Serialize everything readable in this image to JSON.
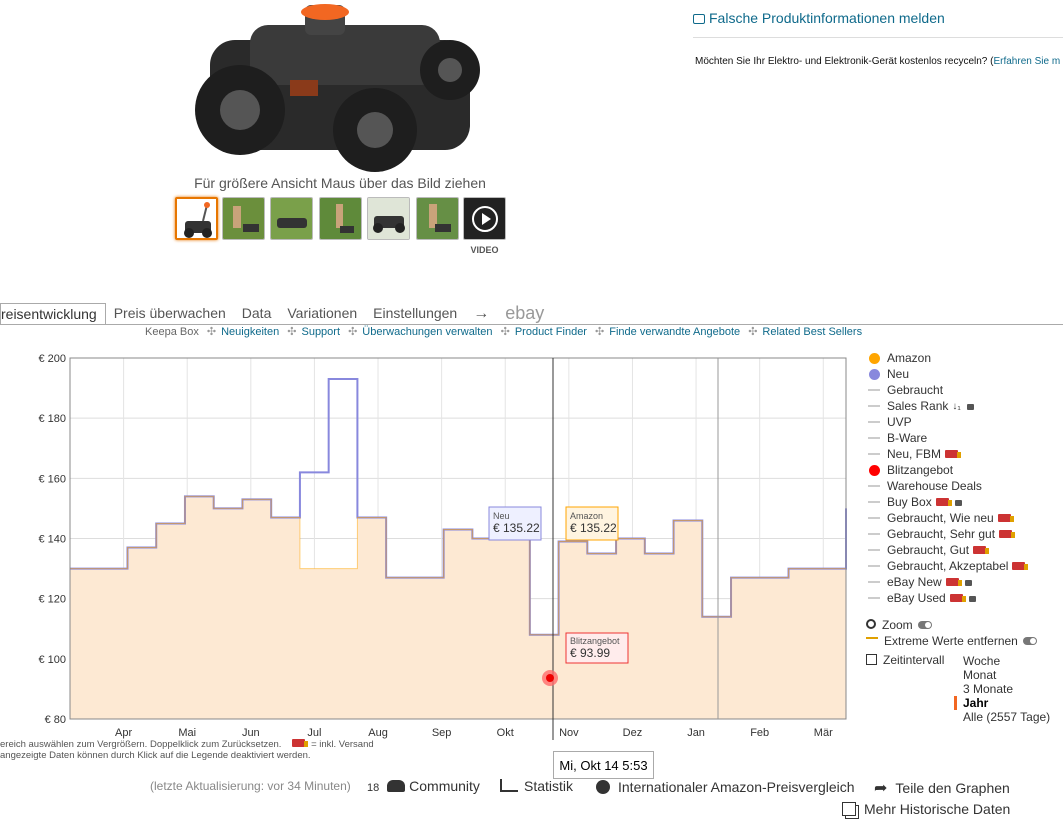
{
  "product": {
    "hover_hint": "Für größere Ansicht Maus über das Bild ziehen",
    "thumbnails": [
      "thumb-1",
      "thumb-2",
      "thumb-3",
      "thumb-4",
      "thumb-5",
      "thumb-6"
    ],
    "video_label": "VIDEO"
  },
  "report": {
    "label": "Falsche Produktinformationen melden",
    "recycle_text": "Möchten Sie Ihr Elektro- und Elektronik-Gerät kostenlos recyceln? (",
    "recycle_link": "Erfahren Sie m"
  },
  "tabs": [
    {
      "label": "reisentwicklung",
      "active": true
    },
    {
      "label": "Preis überwachen"
    },
    {
      "label": "Data"
    },
    {
      "label": "Variationen"
    },
    {
      "label": "Einstellungen"
    },
    {
      "label": "→"
    },
    {
      "label": "ebay"
    }
  ],
  "links": {
    "keepa_box": "Keepa Box",
    "items": [
      "Neuigkeiten",
      "Support",
      "Überwachungen verwalten",
      "Product Finder",
      "Finde verwandte Angebote",
      "Related Best Sellers"
    ]
  },
  "chart_data": {
    "type": "line",
    "y_ticks": [
      "€ 200",
      "€ 180",
      "€ 160",
      "€ 140",
      "€ 120",
      "€ 100",
      "€ 80"
    ],
    "ylim": [
      80,
      200
    ],
    "x_ticks": [
      "Apr",
      "Mai",
      "Jun",
      "Jul",
      "Aug",
      "Sep",
      "Okt",
      "Nov",
      "Dez",
      "Jan",
      "Feb",
      "Mär"
    ],
    "series": [
      {
        "name": "Neu",
        "color": "#8888dd",
        "values": [
          130,
          130,
          137,
          145,
          154,
          150,
          153,
          147,
          162,
          193,
          147,
          127,
          127,
          143,
          140,
          143,
          108,
          139,
          135,
          140,
          135,
          146,
          114,
          127,
          127,
          130,
          130,
          150
        ]
      },
      {
        "name": "Amazon",
        "color": "#ffa500",
        "values": [
          130,
          130,
          137,
          145,
          154,
          150,
          153,
          147,
          130,
          130,
          147,
          127,
          127,
          143,
          140,
          143,
          108,
          139,
          135,
          140,
          135,
          146,
          114,
          127,
          127,
          130,
          130,
          150
        ]
      }
    ],
    "tooltips": {
      "neu": {
        "label": "Neu",
        "value": "€ 135.22"
      },
      "amazon": {
        "label": "Amazon",
        "value": "€ 135.22"
      },
      "blitz": {
        "label": "Blitzangebot",
        "value": "€ 93.99"
      },
      "date": "Mi, Okt 14 5:53"
    }
  },
  "legend": {
    "items": [
      {
        "label": "Amazon",
        "kind": "dot",
        "color": "#ffa500"
      },
      {
        "label": "Neu",
        "kind": "dot",
        "color": "#8888dd"
      },
      {
        "label": "Gebraucht",
        "kind": "dash"
      },
      {
        "label": "Sales Rank",
        "kind": "dash",
        "sort": true,
        "lock": true
      },
      {
        "label": "UVP",
        "kind": "dash"
      },
      {
        "label": "B-Ware",
        "kind": "dash"
      },
      {
        "label": "Neu, FBM",
        "kind": "dash",
        "truck": true
      },
      {
        "label": "Blitzangebot",
        "kind": "dot",
        "color": "#ff0000"
      },
      {
        "label": "Warehouse Deals",
        "kind": "dash"
      },
      {
        "label": "Buy Box",
        "kind": "dash",
        "truck": true,
        "lock": true
      },
      {
        "label": "Gebraucht, Wie neu",
        "kind": "dash",
        "truck": true
      },
      {
        "label": "Gebraucht, Sehr gut",
        "kind": "dash",
        "truck": true
      },
      {
        "label": "Gebraucht, Gut",
        "kind": "dash",
        "truck": true
      },
      {
        "label": "Gebraucht, Akzeptabel",
        "kind": "dash",
        "truck": true
      },
      {
        "label": "eBay New",
        "kind": "dash",
        "truck": true,
        "lock": true
      },
      {
        "label": "eBay Used",
        "kind": "dash",
        "truck": true,
        "lock": true
      }
    ],
    "zoom": "Zoom",
    "extreme": "Extreme Werte entfernen",
    "interval": "Zeitintervall",
    "ranges": [
      "Woche",
      "Monat",
      "3 Monate",
      "Jahr",
      "Alle (2557 Tage)"
    ],
    "selected_range": "Jahr"
  },
  "notes": {
    "line1_a": "ereich auswählen zum Vergrößern. Doppelklick zum Zurücksetzen.",
    "line1_b": "= inkl. Versand",
    "line2": "angezeigte Daten können durch Klick auf die Legende deaktiviert werden."
  },
  "footer": {
    "update": "(letzte Aktualisierung: vor 34 Minuten)",
    "community_count": "18",
    "community": "Community",
    "statistik": "Statistik",
    "international": "Internationaler Amazon-Preisvergleich",
    "share": "Teile den Graphen",
    "more_history": "Mehr Historische Daten"
  }
}
